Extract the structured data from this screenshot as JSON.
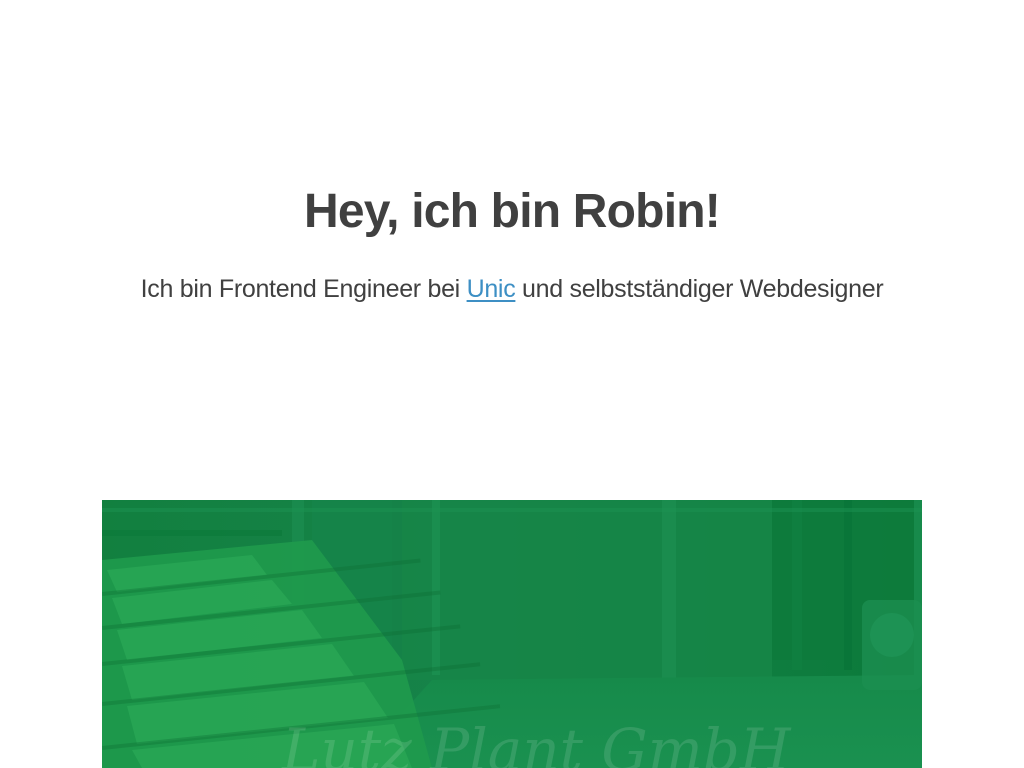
{
  "hero": {
    "headline": "Hey, ich bin Robin!",
    "tagline_before": "Ich bin Frontend Engineer bei ",
    "tagline_link": "Unic",
    "tagline_after": " und selbstständiger Webdesigner"
  },
  "project_teaser": {
    "signature_text": "Lutz Plant GmbH"
  },
  "colors": {
    "text": "#404040",
    "link": "#3d8fc4",
    "overlay_green": "#0a7a3c",
    "background": "#ffffff"
  }
}
